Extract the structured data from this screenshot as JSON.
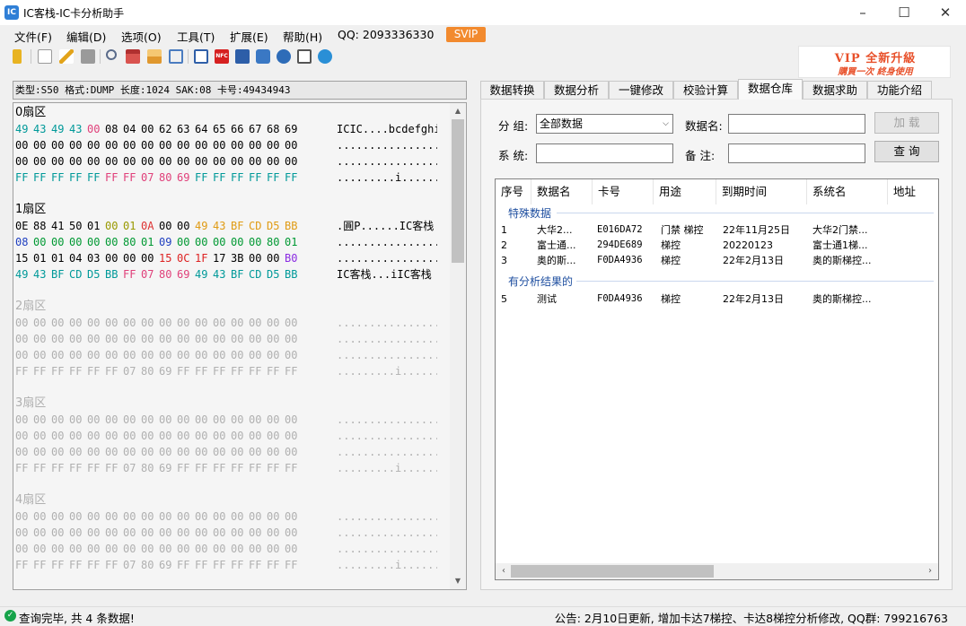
{
  "window": {
    "title": "IC客栈-IC卡分析助手",
    "icon_label": "IC"
  },
  "menu": {
    "items": [
      "文件(F)",
      "编辑(D)",
      "选项(O)",
      "工具(T)",
      "扩展(E)",
      "帮助(H)",
      "QQ: 2093336330"
    ],
    "svip": "SVIP"
  },
  "toolbar": {
    "icons": [
      "open-icon",
      "new-icon",
      "edit-icon",
      "save-icon",
      "search-icon",
      "calendar-icon",
      "chart-icon",
      "tool-icon",
      "read-icon",
      "nfc-icon",
      "device-icon",
      "scan-icon",
      "info-icon",
      "calc-icon",
      "settings-icon"
    ],
    "nfc_text": "NFC"
  },
  "vip": {
    "line1": "VIP 全新升級",
    "line2": "購買一次    終身使用"
  },
  "info_line": "类型:S50 格式:DUMP 长度:1024 SAK:08 卡号:49434943",
  "hex": {
    "sectors": [
      {
        "label": "0扇区",
        "active": true,
        "rows": [
          {
            "bytes": [
              "49",
              "43",
              "49",
              "43",
              "00",
              "08",
              "04",
              "00",
              "62",
              "63",
              "64",
              "65",
              "66",
              "67",
              "68",
              "69"
            ],
            "colors": [
              "#009999",
              "#009999",
              "#009999",
              "#009999",
              "#e0407a",
              "#000",
              "#000",
              "#000",
              "#000",
              "#000",
              "#000",
              "#000",
              "#000",
              "#000",
              "#000",
              "#000"
            ],
            "ascii": "ICIC....bcdefghi"
          },
          {
            "bytes": [
              "00",
              "00",
              "00",
              "00",
              "00",
              "00",
              "00",
              "00",
              "00",
              "00",
              "00",
              "00",
              "00",
              "00",
              "00",
              "00"
            ],
            "colors": [],
            "ascii": "................"
          },
          {
            "bytes": [
              "00",
              "00",
              "00",
              "00",
              "00",
              "00",
              "00",
              "00",
              "00",
              "00",
              "00",
              "00",
              "00",
              "00",
              "00",
              "00"
            ],
            "colors": [],
            "ascii": "................"
          },
          {
            "bytes": [
              "FF",
              "FF",
              "FF",
              "FF",
              "FF",
              "FF",
              "FF",
              "07",
              "80",
              "69",
              "FF",
              "FF",
              "FF",
              "FF",
              "FF",
              "FF"
            ],
            "colors": [
              "#009999",
              "#009999",
              "#009999",
              "#009999",
              "#009999",
              "#e0407a",
              "#e0407a",
              "#e0407a",
              "#e0407a",
              "#e0407a",
              "#009999",
              "#009999",
              "#009999",
              "#009999",
              "#009999",
              "#009999"
            ],
            "ascii": ".........i......"
          }
        ]
      },
      {
        "label": "1扇区",
        "active": true,
        "rows": [
          {
            "bytes": [
              "0E",
              "88",
              "41",
              "50",
              "01",
              "00",
              "01",
              "0A",
              "00",
              "00",
              "49",
              "43",
              "BF",
              "CD",
              "D5",
              "BB"
            ],
            "colors": [
              "#000",
              "#000",
              "#000",
              "#000",
              "#000",
              "#999900",
              "#999900",
              "#dd3333",
              "#000",
              "#000",
              "#e09b14",
              "#e09b14",
              "#e09b14",
              "#e09b14",
              "#e09b14",
              "#e09b14"
            ],
            "ascii": ".圓P......IC客栈"
          },
          {
            "bytes": [
              "08",
              "00",
              "00",
              "00",
              "00",
              "00",
              "80",
              "01",
              "09",
              "00",
              "00",
              "00",
              "00",
              "00",
              "80",
              "01"
            ],
            "colors": [
              "#1f3fc0",
              "#009933",
              "#009933",
              "#009933",
              "#009933",
              "#009933",
              "#009933",
              "#009933",
              "#1f3fc0",
              "#009933",
              "#009933",
              "#009933",
              "#009933",
              "#009933",
              "#009933",
              "#009933"
            ],
            "ascii": "................"
          },
          {
            "bytes": [
              "15",
              "01",
              "01",
              "04",
              "03",
              "00",
              "00",
              "00",
              "15",
              "0C",
              "1F",
              "17",
              "3B",
              "00",
              "00",
              "B0"
            ],
            "colors": [
              "#000",
              "#000",
              "#000",
              "#000",
              "#000",
              "#000",
              "#000",
              "#000",
              "#dd2222",
              "#dd2222",
              "#dd2222",
              "#000",
              "#000",
              "#000",
              "#000",
              "#8a2be2"
            ],
            "ascii": "................"
          },
          {
            "bytes": [
              "49",
              "43",
              "BF",
              "CD",
              "D5",
              "BB",
              "FF",
              "07",
              "80",
              "69",
              "49",
              "43",
              "BF",
              "CD",
              "D5",
              "BB"
            ],
            "colors": [
              "#009999",
              "#009999",
              "#009999",
              "#009999",
              "#009999",
              "#009999",
              "#e0407a",
              "#e0407a",
              "#e0407a",
              "#e0407a",
              "#009999",
              "#009999",
              "#009999",
              "#009999",
              "#009999",
              "#009999"
            ],
            "ascii": "IC客栈...iIC客栈"
          }
        ]
      },
      {
        "label": "2扇区",
        "active": false,
        "rows": [
          {
            "bytes": [
              "00",
              "00",
              "00",
              "00",
              "00",
              "00",
              "00",
              "00",
              "00",
              "00",
              "00",
              "00",
              "00",
              "00",
              "00",
              "00"
            ],
            "ascii": "................"
          },
          {
            "bytes": [
              "00",
              "00",
              "00",
              "00",
              "00",
              "00",
              "00",
              "00",
              "00",
              "00",
              "00",
              "00",
              "00",
              "00",
              "00",
              "00"
            ],
            "ascii": "................"
          },
          {
            "bytes": [
              "00",
              "00",
              "00",
              "00",
              "00",
              "00",
              "00",
              "00",
              "00",
              "00",
              "00",
              "00",
              "00",
              "00",
              "00",
              "00"
            ],
            "ascii": "................"
          },
          {
            "bytes": [
              "FF",
              "FF",
              "FF",
              "FF",
              "FF",
              "FF",
              "07",
              "80",
              "69",
              "FF",
              "FF",
              "FF",
              "FF",
              "FF",
              "FF",
              "FF"
            ],
            "ascii": ".........i......"
          }
        ]
      },
      {
        "label": "3扇区",
        "active": false,
        "rows": [
          {
            "bytes": [
              "00",
              "00",
              "00",
              "00",
              "00",
              "00",
              "00",
              "00",
              "00",
              "00",
              "00",
              "00",
              "00",
              "00",
              "00",
              "00"
            ],
            "ascii": "................"
          },
          {
            "bytes": [
              "00",
              "00",
              "00",
              "00",
              "00",
              "00",
              "00",
              "00",
              "00",
              "00",
              "00",
              "00",
              "00",
              "00",
              "00",
              "00"
            ],
            "ascii": "................"
          },
          {
            "bytes": [
              "00",
              "00",
              "00",
              "00",
              "00",
              "00",
              "00",
              "00",
              "00",
              "00",
              "00",
              "00",
              "00",
              "00",
              "00",
              "00"
            ],
            "ascii": "................"
          },
          {
            "bytes": [
              "FF",
              "FF",
              "FF",
              "FF",
              "FF",
              "FF",
              "07",
              "80",
              "69",
              "FF",
              "FF",
              "FF",
              "FF",
              "FF",
              "FF",
              "FF"
            ],
            "ascii": ".........i......"
          }
        ]
      },
      {
        "label": "4扇区",
        "active": false,
        "rows": [
          {
            "bytes": [
              "00",
              "00",
              "00",
              "00",
              "00",
              "00",
              "00",
              "00",
              "00",
              "00",
              "00",
              "00",
              "00",
              "00",
              "00",
              "00"
            ],
            "ascii": "................"
          },
          {
            "bytes": [
              "00",
              "00",
              "00",
              "00",
              "00",
              "00",
              "00",
              "00",
              "00",
              "00",
              "00",
              "00",
              "00",
              "00",
              "00",
              "00"
            ],
            "ascii": "................"
          },
          {
            "bytes": [
              "00",
              "00",
              "00",
              "00",
              "00",
              "00",
              "00",
              "00",
              "00",
              "00",
              "00",
              "00",
              "00",
              "00",
              "00",
              "00"
            ],
            "ascii": "................"
          },
          {
            "bytes": [
              "FF",
              "FF",
              "FF",
              "FF",
              "FF",
              "FF",
              "07",
              "80",
              "69",
              "FF",
              "FF",
              "FF",
              "FF",
              "FF",
              "FF",
              "FF"
            ],
            "ascii": ".........i......"
          }
        ]
      }
    ]
  },
  "tabs": [
    "数据转换",
    "数据分析",
    "一键修改",
    "校验计算",
    "数据仓库",
    "数据求助",
    "功能介绍"
  ],
  "active_tab": "数据仓库",
  "form": {
    "group_label": "分  组:",
    "group_value": "全部数据",
    "name_label": "数据名:",
    "name_value": "",
    "system_label": "系  统:",
    "system_value": "",
    "note_label": "备  注:",
    "note_value": "",
    "load_button": "加 载",
    "query_button": "查 询"
  },
  "list": {
    "columns": [
      "序号",
      "数据名",
      "卡号",
      "用途",
      "到期时间",
      "系统名",
      "地址"
    ],
    "groups": [
      {
        "title": "特殊数据",
        "rows": [
          [
            "1",
            "大华2...",
            "E016DA72",
            "门禁 梯控",
            "22年11月25日",
            "大华2门禁..."
          ],
          [
            "2",
            "富士通...",
            "294DE689",
            "梯控",
            "20220123",
            "富士通1梯..."
          ],
          [
            "3",
            "奥的斯...",
            "F0DA4936",
            "梯控",
            "22年2月13日",
            "奥的斯梯控..."
          ]
        ]
      },
      {
        "title": "有分析结果的",
        "rows": [
          [
            "5",
            "测试",
            "F0DA4936",
            "梯控",
            "22年2月13日",
            "奥的斯梯控..."
          ]
        ]
      }
    ]
  },
  "status": {
    "text": "查询完毕, 共 4 条数据!",
    "notice": "公告: 2月10日更新, 增加卡达7梯控、卡达8梯控分析修改, QQ群: 799216763"
  }
}
